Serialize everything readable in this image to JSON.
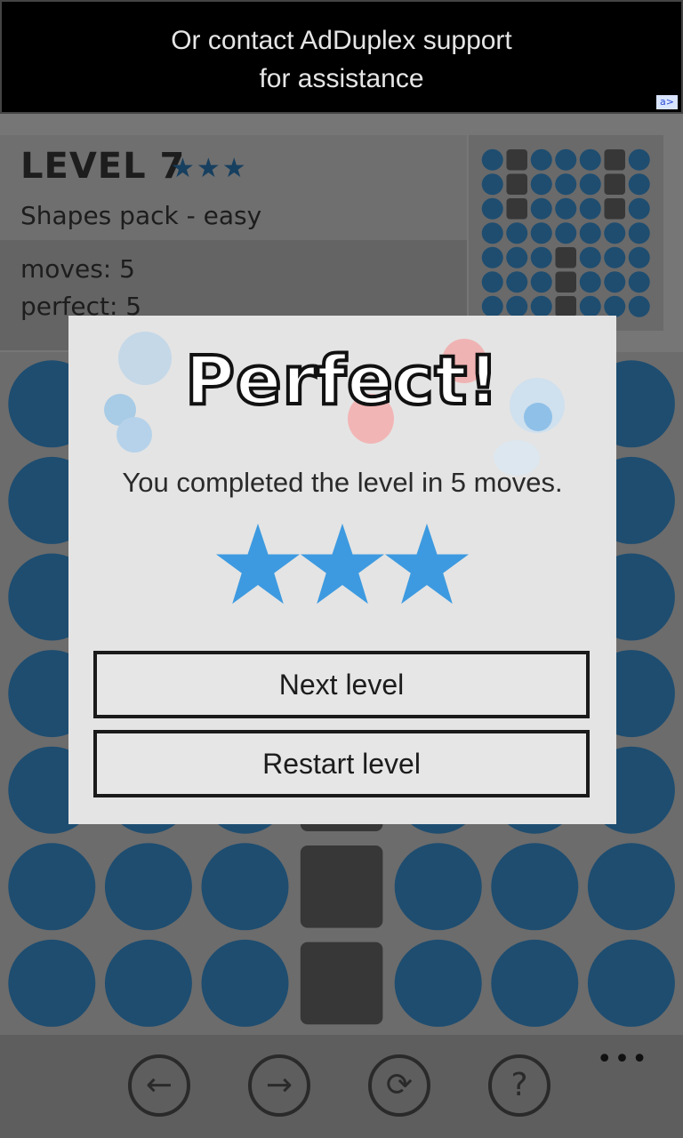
{
  "ad": {
    "line1": "Or contact AdDuplex support",
    "line2": "for assistance",
    "badge": "a>"
  },
  "header": {
    "level_title": "LEVEL 7",
    "level_stars": "★★★",
    "pack_name": "Shapes pack - easy",
    "moves": "moves: 5",
    "perfect": "perfect: 5"
  },
  "preview_grid": [
    [
      0,
      1,
      0,
      0,
      0,
      1,
      0
    ],
    [
      0,
      1,
      0,
      0,
      0,
      1,
      0
    ],
    [
      0,
      1,
      0,
      0,
      0,
      1,
      0
    ],
    [
      0,
      0,
      0,
      0,
      0,
      0,
      0
    ],
    [
      0,
      0,
      0,
      1,
      0,
      0,
      0
    ],
    [
      0,
      0,
      0,
      1,
      0,
      0,
      0
    ],
    [
      0,
      0,
      0,
      1,
      0,
      0,
      0
    ]
  ],
  "board_grid": [
    [
      0,
      0,
      0,
      0,
      0,
      0,
      0
    ],
    [
      0,
      0,
      0,
      0,
      0,
      0,
      0
    ],
    [
      0,
      0,
      0,
      0,
      0,
      0,
      0
    ],
    [
      0,
      0,
      0,
      0,
      0,
      0,
      0
    ],
    [
      0,
      0,
      0,
      1,
      0,
      0,
      0
    ],
    [
      0,
      0,
      0,
      1,
      0,
      0,
      0
    ],
    [
      0,
      0,
      0,
      1,
      0,
      0,
      0
    ]
  ],
  "colors": {
    "dot": "#3d9ae0",
    "block": "#6f6f6f",
    "star": "#3d9ae0"
  },
  "toolbar": {
    "buttons": [
      {
        "icon": "arrow-left-icon",
        "glyph": "←"
      },
      {
        "icon": "arrow-right-icon",
        "glyph": "→"
      },
      {
        "icon": "refresh-icon",
        "glyph": "⟳"
      },
      {
        "icon": "help-icon",
        "glyph": "?"
      }
    ],
    "more": "•••"
  },
  "dialog": {
    "title": "Perfect!",
    "message": "You completed the level in 5 moves.",
    "stars_earned": 3,
    "next_label": "Next level",
    "restart_label": "Restart level"
  }
}
